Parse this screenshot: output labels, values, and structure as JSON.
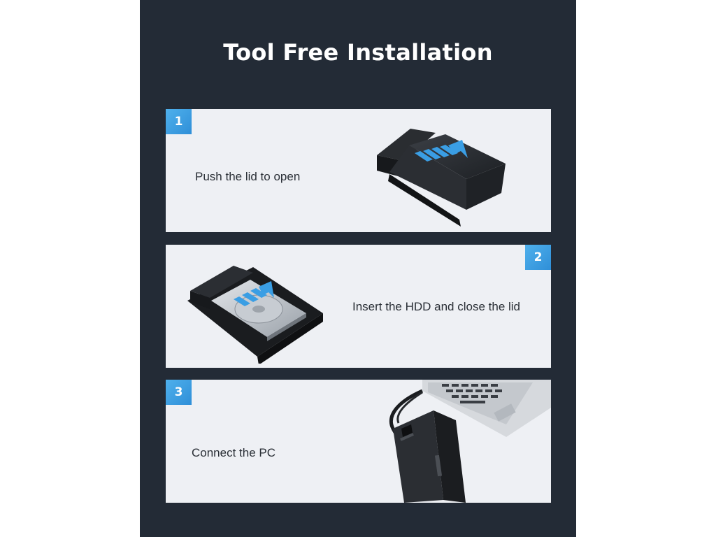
{
  "title": "Tool Free Installation",
  "accent_color": "#3a9ee4",
  "background_color": "#232b36",
  "steps": [
    {
      "number": "1",
      "text": "Push the lid to open",
      "icon": "enclosure-open-arrow-icon"
    },
    {
      "number": "2",
      "text": "Insert the HDD and close the lid",
      "icon": "hdd-insert-icon"
    },
    {
      "number": "3",
      "text": "Connect the PC",
      "icon": "laptop-connect-icon"
    }
  ]
}
